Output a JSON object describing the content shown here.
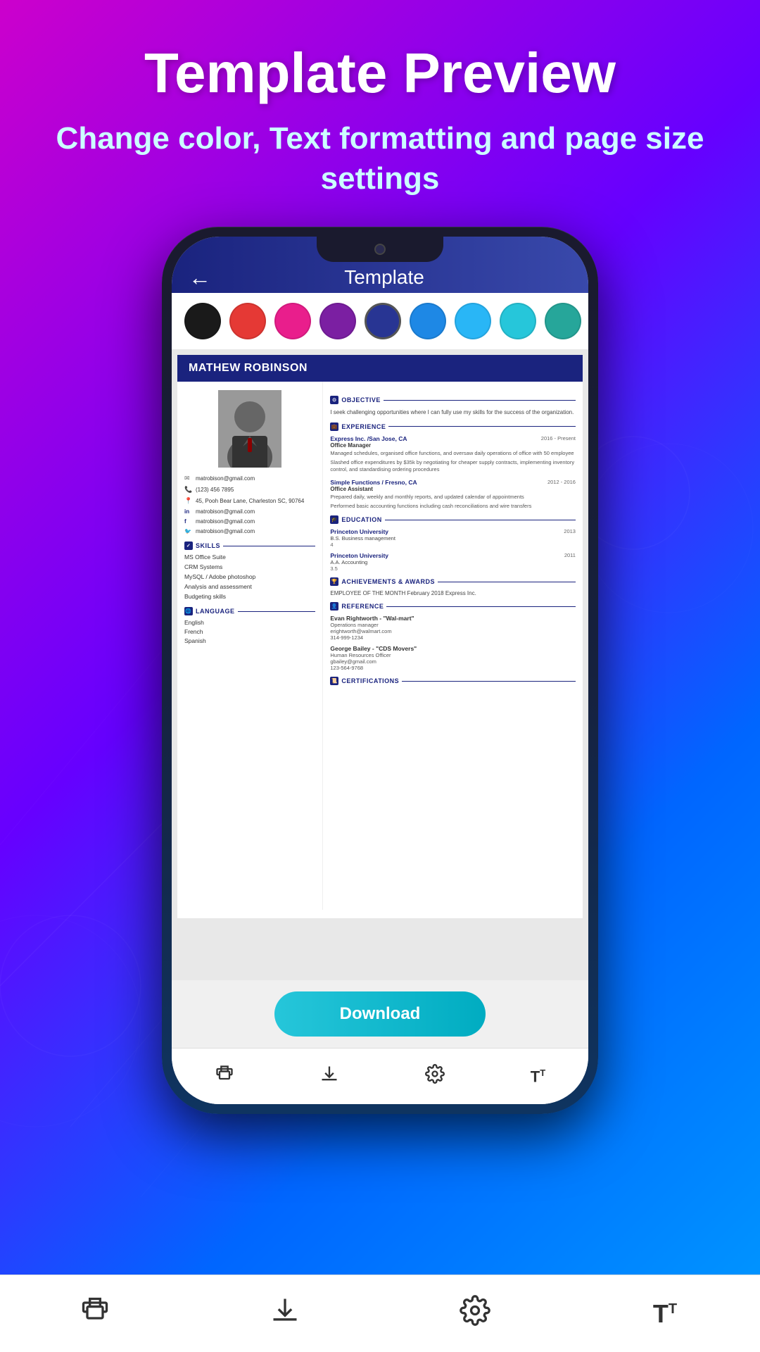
{
  "page": {
    "background_gradient": "linear-gradient(135deg, #cc00cc, #6600ff, #0066ff, #0099ff)"
  },
  "header": {
    "title": "Template Preview",
    "subtitle": "Change color, Text formatting and page size settings"
  },
  "phone": {
    "app_header": {
      "back_label": "←",
      "title": "Template"
    },
    "colors": [
      {
        "name": "black",
        "hex": "#1a1a1a"
      },
      {
        "name": "red",
        "hex": "#e53935"
      },
      {
        "name": "pink",
        "hex": "#e91e8c"
      },
      {
        "name": "purple",
        "hex": "#7b1fa2"
      },
      {
        "name": "navy",
        "hex": "#283593"
      },
      {
        "name": "blue",
        "hex": "#1e88e5"
      },
      {
        "name": "light-blue",
        "hex": "#29b6f6"
      },
      {
        "name": "teal",
        "hex": "#26c6da"
      },
      {
        "name": "mint",
        "hex": "#26a69a"
      },
      {
        "name": "green",
        "hex": "#2e7d32"
      }
    ],
    "resume": {
      "candidate_name": "MATHEW ROBINSON",
      "left": {
        "contact": [
          {
            "icon": "✉",
            "text": "matrobison@gmail.com"
          },
          {
            "icon": "📞",
            "text": "(123) 456 7895"
          },
          {
            "icon": "📍",
            "text": "45, Pooh Bear Lane, Charleston SC, 90764"
          },
          {
            "icon": "in",
            "text": "matrobison@gmail.com"
          },
          {
            "icon": "f",
            "text": "matrobison@gmail.com"
          },
          {
            "icon": "🐦",
            "text": "matrobison@gmail.com"
          }
        ],
        "skills_section": "SKILLS",
        "skills": [
          "MS Office Suite",
          "CRM Systems",
          "MySQL / Adobe photoshop",
          "Analysis and assessment",
          "Budgeting skills"
        ],
        "language_section": "LANGUAGE",
        "languages": [
          "English",
          "French",
          "Spanish"
        ]
      },
      "right": {
        "objective_section": "OBJECTIVE",
        "objective_text": "I seek challenging opportunities where I can fully use my skills for the success of the organization.",
        "experience_section": "EXPERIENCE",
        "experiences": [
          {
            "company": "Express Inc. /San Jose, CA",
            "date": "2016 - Present",
            "role": "Office Manager",
            "desc": "Managed schedules, organised office functions, and oversaw daily operations of office with 50 employee\n\nSlashed office expenditures by $35k by negotiating for cheaper supply contracts, implementing inventory control, and standardising ordering procedures"
          },
          {
            "company": "Simple Functions / Fresno, CA",
            "date": "2012 - 2016",
            "role": "Office Assistant",
            "desc": "Prepared daily, weekly and monthly reports, and updated calendar of appointments\n\nPerformed basic accounting functions including cash reconciliations and wire transfers"
          }
        ],
        "education_section": "EDUCATION",
        "educations": [
          {
            "school": "Princeton University",
            "year": "2013",
            "degree": "B.S. Business management",
            "gpa": "4"
          },
          {
            "school": "Princeton University",
            "year": "2011",
            "degree": "A.A. Accounting",
            "gpa": "3.5"
          }
        ],
        "achievements_section": "ACHIEVEMENTS & AWARDS",
        "achievement_text": "EMPLOYEE OF THE MONTH February 2018 Express Inc.",
        "reference_section": "REFERENCE",
        "references": [
          {
            "name": "Evan Rightworth - \"Wal-mart\"",
            "role": "Operations manager",
            "email": "erightworth@walmart.com",
            "phone": "314-999-1234"
          },
          {
            "name": "George Bailey - \"CDS Movers\"",
            "role": "Human Resources Officer",
            "email": "gbailey@gmail.com",
            "phone": "123-564-9768"
          }
        ],
        "certifications_section": "CERTIFICATIONS"
      }
    },
    "download_button": "Download",
    "bottom_nav": [
      {
        "icon": "🖨",
        "name": "print"
      },
      {
        "icon": "⬇",
        "name": "download"
      },
      {
        "icon": "⚙",
        "name": "settings"
      },
      {
        "icon": "T↕",
        "name": "font-size"
      }
    ]
  },
  "page_bottom_nav": [
    {
      "icon": "🖨",
      "name": "print-icon"
    },
    {
      "icon": "⬇",
      "name": "download-nav-icon"
    },
    {
      "icon": "⚙",
      "name": "settings-icon"
    },
    {
      "icon": "TT",
      "name": "font-icon"
    }
  ]
}
